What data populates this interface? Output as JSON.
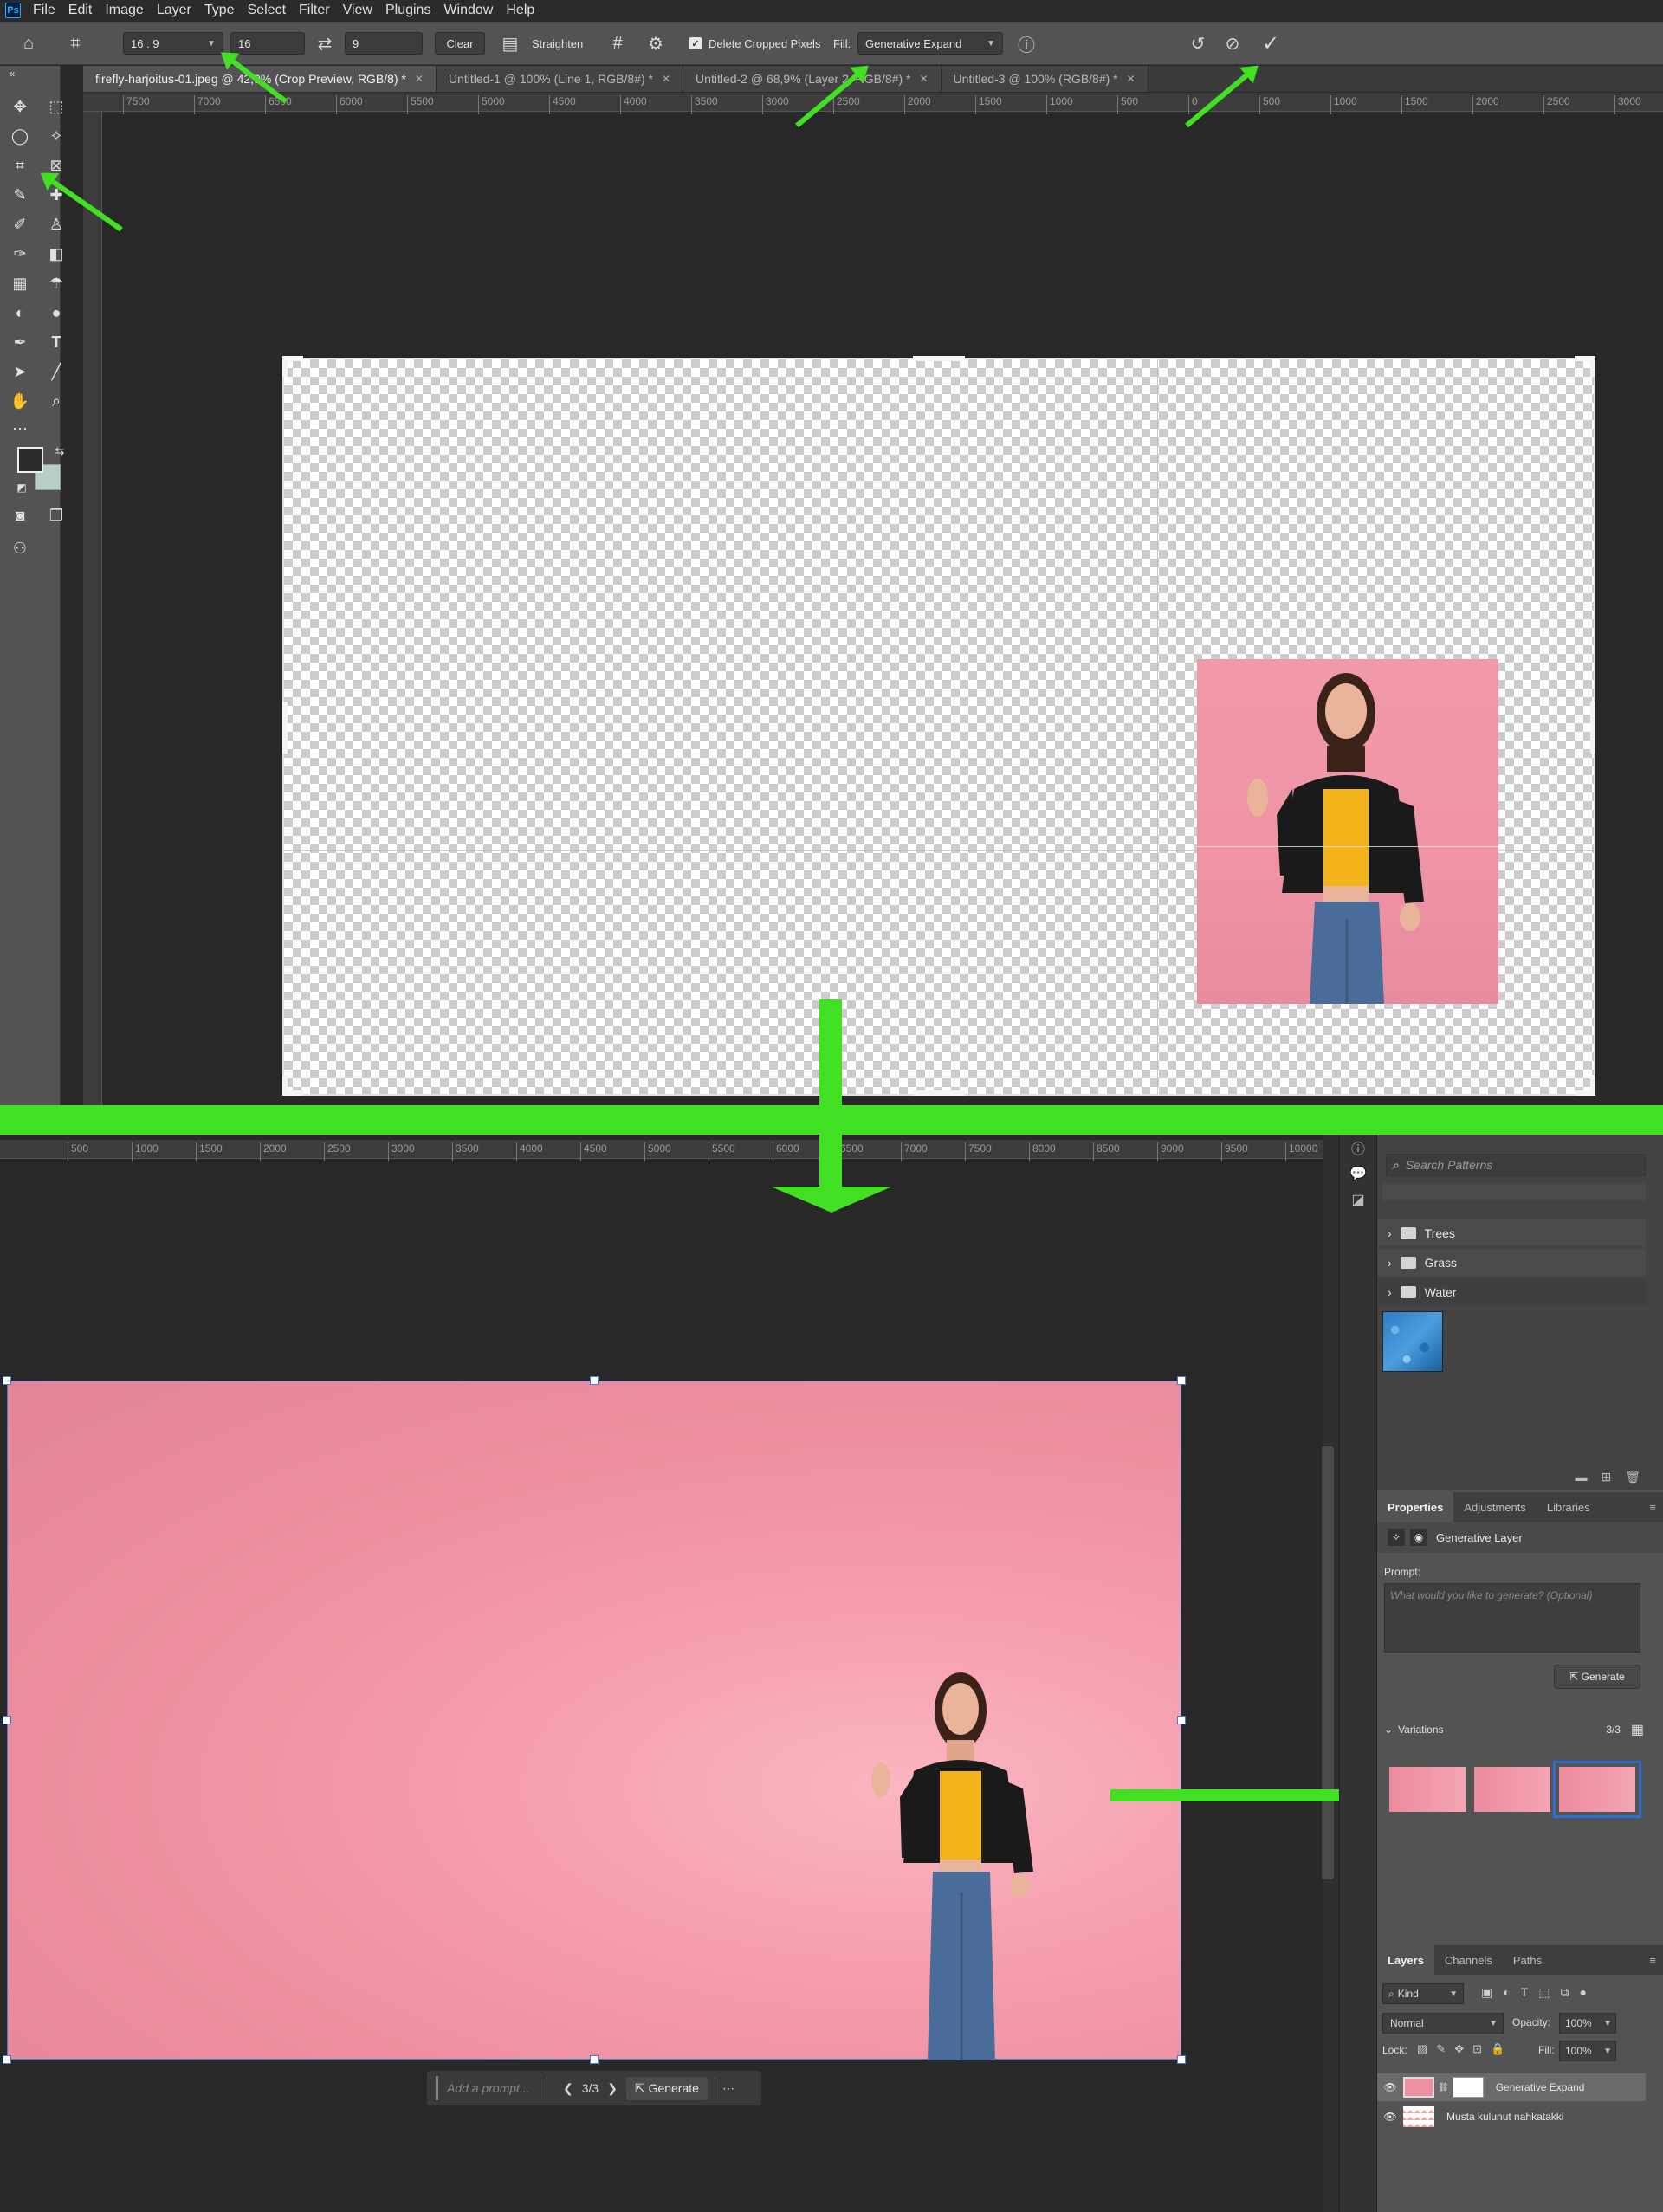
{
  "app": {
    "logo": "Ps"
  },
  "menu": [
    "File",
    "Edit",
    "Image",
    "Layer",
    "Type",
    "Select",
    "Filter",
    "View",
    "Plugins",
    "Window",
    "Help"
  ],
  "options_bar": {
    "ratio_preset": "16 : 9",
    "width_value": "16",
    "height_value": "9",
    "clear_label": "Clear",
    "straighten_label": "Straighten",
    "delete_cropped_label": "Delete Cropped Pixels",
    "fill_label": "Fill:",
    "fill_value": "Generative Expand",
    "delete_cropped_checked": true
  },
  "doc_tabs": [
    {
      "label": "firefly-harjoitus-01.jpeg @ 42,9% (Crop Preview, RGB/8) *",
      "active": true
    },
    {
      "label": "Untitled-1 @ 100% (Line 1, RGB/8#) *",
      "active": false
    },
    {
      "label": "Untitled-2 @ 68,9% (Layer 2, RGB/8#) *",
      "active": false
    },
    {
      "label": "Untitled-3 @ 100% (RGB/8#) *",
      "active": false
    }
  ],
  "ruler_top": [
    "7500",
    "7000",
    "6500",
    "6000",
    "5500",
    "5000",
    "4500",
    "4000",
    "3500",
    "3000",
    "2500",
    "2000",
    "1500",
    "1000",
    "500",
    "0",
    "500",
    "1000",
    "1500",
    "2000",
    "2500",
    "3000"
  ],
  "ruler_bottom": [
    "500",
    "1000",
    "1500",
    "2000",
    "2500",
    "3000",
    "3500",
    "4000",
    "4500",
    "5000",
    "5500",
    "6000",
    "6500",
    "7000",
    "7500",
    "8000",
    "8500",
    "9000",
    "9500",
    "10000"
  ],
  "context_bar": {
    "prompt_placeholder": "Add a prompt...",
    "counter": "3/3",
    "generate_label": "Generate"
  },
  "patterns": {
    "search_placeholder": "Search Patterns",
    "folders": [
      "Trees",
      "Grass",
      "Water"
    ]
  },
  "properties": {
    "tabs": [
      "Properties",
      "Adjustments",
      "Libraries"
    ],
    "layer_type": "Generative Layer",
    "prompt_label": "Prompt:",
    "prompt_placeholder": "What would you like to generate? (Optional)",
    "generate_label": "Generate",
    "variations_label": "Variations",
    "variations_count": "3/3"
  },
  "layers": {
    "tabs": [
      "Layers",
      "Channels",
      "Paths"
    ],
    "kind_label": "Kind",
    "blend_mode": "Normal",
    "opacity_label": "Opacity:",
    "opacity_value": "100%",
    "lock_label": "Lock:",
    "fill_label": "Fill:",
    "fill_value": "100%",
    "items": [
      {
        "name": "Generative Expand",
        "selected": true
      },
      {
        "name": "Musta kulunut nahkatakki",
        "selected": false
      }
    ]
  },
  "colors": {
    "accent_green": "#41e022",
    "selection_blue": "#4a7bd0",
    "foreground": "#2a2a2a",
    "background": "#b8cfc7"
  }
}
